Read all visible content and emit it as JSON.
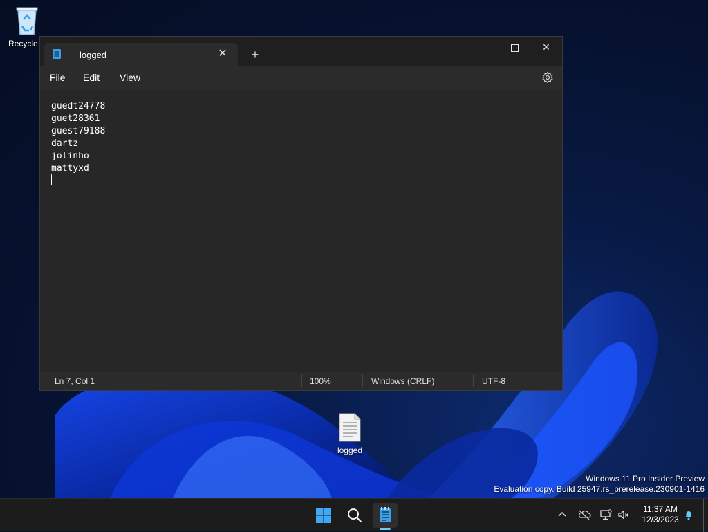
{
  "desktop": {
    "icons": [
      {
        "label": "Recycle B",
        "icon": "recycle-bin-icon"
      },
      {
        "label": "logged",
        "icon": "text-file-icon"
      }
    ],
    "watermark": {
      "line1": "Windows 11 Pro Insider Preview",
      "line2": "Evaluation copy. Build 25947.rs_prerelease.230901-1416"
    }
  },
  "notepad": {
    "tab_title": "logged",
    "tab_close_icon": "close-icon",
    "new_tab_icon": "plus-icon",
    "window_controls": {
      "minimize": "minimize-icon",
      "maximize": "maximize-icon",
      "close": "close-icon"
    },
    "menu": [
      "File",
      "Edit",
      "View"
    ],
    "settings_icon": "gear-icon",
    "content_lines": [
      "guedt24778",
      "guet28361",
      "guest79188",
      "dartz",
      "jolinho",
      "mattyxd"
    ],
    "status": {
      "position": "Ln 7, Col 1",
      "zoom": "100%",
      "line_ending": "Windows (CRLF)",
      "encoding": "UTF-8"
    }
  },
  "taskbar": {
    "clock_time": "11:37 AM",
    "clock_date": "12/3/2023",
    "accent_color": "#60cdff"
  }
}
